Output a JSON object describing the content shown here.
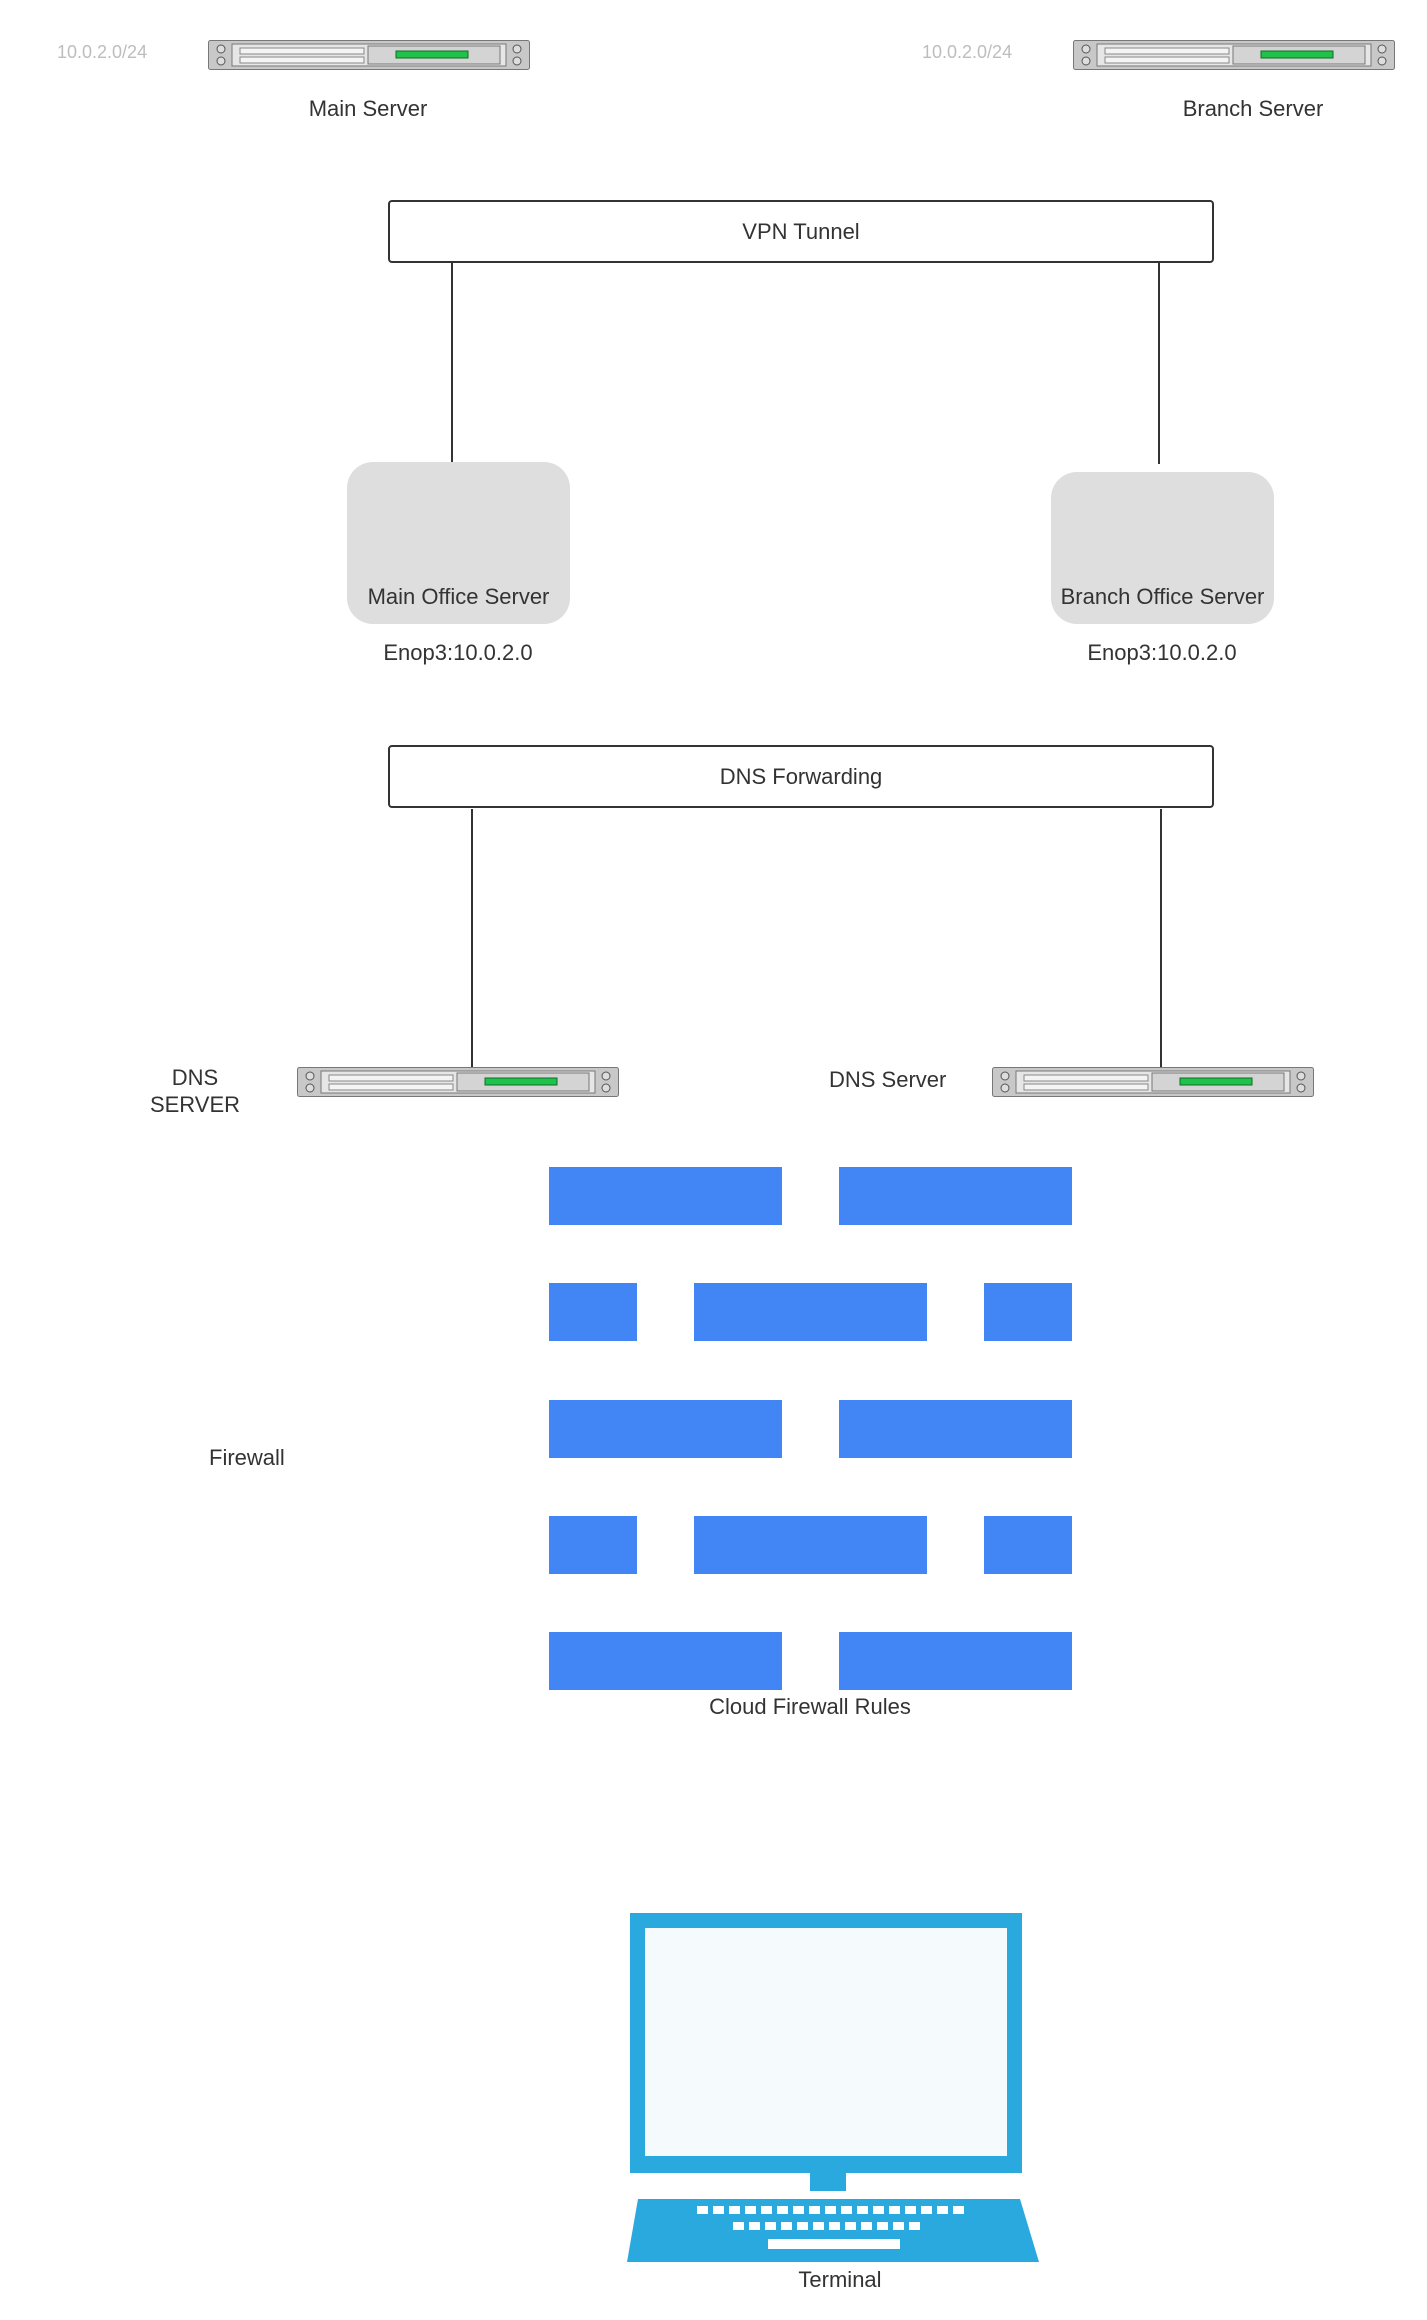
{
  "colors": {
    "line": "#333333",
    "server_body": "#c8c8c8",
    "server_led": "#1fc24a",
    "rounded_node": "#dedede",
    "firewall_brick": "#4285f4",
    "terminal": "#2aa9df"
  },
  "top": {
    "main": {
      "subnet": "10.0.2.0/24",
      "label": "Main Server",
      "icon": "rack-server-icon"
    },
    "branch": {
      "subnet": "10.0.2.0/24",
      "label": "Branch Server",
      "icon": "rack-server-icon"
    }
  },
  "vpn": {
    "label": "VPN Tunnel"
  },
  "offices": {
    "main": {
      "label": "Main Office Server",
      "interface": "Enop3:10.0.2.0"
    },
    "branch": {
      "label": "Branch Office Server",
      "interface": "Enop3:10.0.2.0"
    }
  },
  "dns_forwarding": {
    "label": "DNS Forwarding"
  },
  "dns": {
    "left": {
      "label_line1": "DNS",
      "label_line2": "SERVER",
      "icon": "rack-server-icon"
    },
    "right": {
      "label": "DNS Server",
      "icon": "rack-server-icon"
    }
  },
  "firewall": {
    "side_label": "Firewall",
    "caption": "Cloud Firewall Rules",
    "icon": "brick-wall-icon"
  },
  "terminal": {
    "label": "Terminal",
    "icon": "laptop-icon"
  }
}
